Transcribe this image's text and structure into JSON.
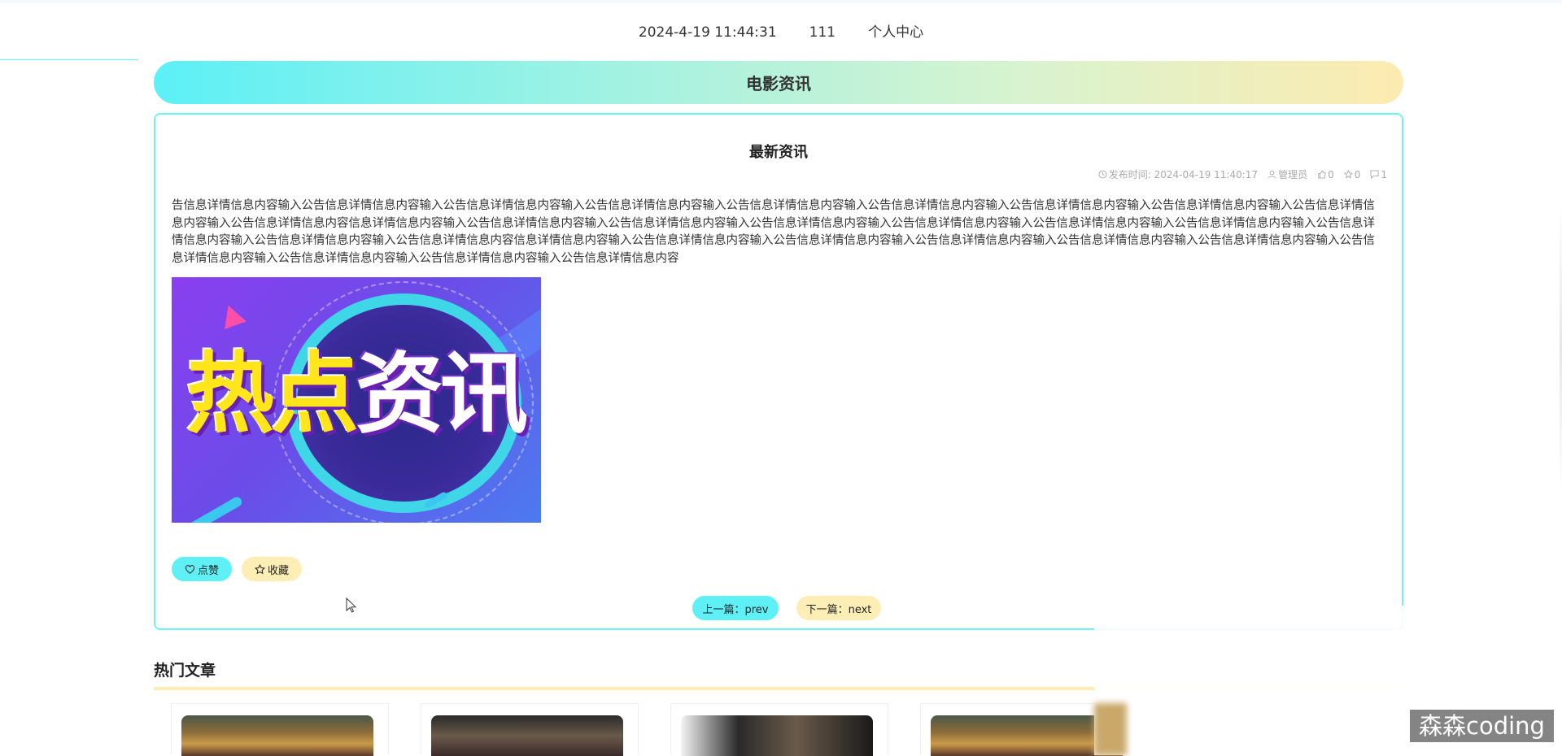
{
  "header": {
    "datetime": "2024-4-19 11:44:31",
    "username": "111",
    "profile_link": "个人中心"
  },
  "banner": {
    "title": "电影资讯"
  },
  "article": {
    "title": "最新资讯",
    "meta": {
      "publish_label": "发布时间: 2024-04-19 11:40:17",
      "author": "管理员",
      "likes": "0",
      "favorites": "0",
      "comments": "1"
    },
    "content": "告信息详情信息内容输入公告信息详情信息内容输入公告信息详情信息内容输入公告信息详情信息内容输入公告信息详情信息内容输入公告信息详情信息内容输入公告信息详情信息内容输入公告信息详情信息内容输入公告信息详情信息内容输入公告信息详情信息内容信息详情信息内容输入公告信息详情信息内容输入公告信息详情信息内容输入公告信息详情信息内容输入公告信息详情信息内容输入公告信息详情信息内容输入公告信息详情信息内容输入公告信息详情信息内容输入公告信息详情信息内容输入公告信息详情信息内容信息详情信息内容输入公告信息详情信息内容输入公告信息详情信息内容输入公告信息详情信息内容输入公告信息详情信息内容输入公告信息详情信息内容输入公告信息详情信息内容输入公告信息详情信息内容输入公告信息详情信息内容输入公告信息详情信息内容",
    "poster_text_yellow": "热点",
    "poster_text_white": "资讯",
    "like_label": "点赞",
    "favorite_label": "收藏",
    "prev_label": "上一篇：prev",
    "next_label": "下一篇：next"
  },
  "hot": {
    "title": "热门文章"
  },
  "watermark": "森森coding",
  "colors": {
    "accent_cyan": "#5ff0f5",
    "accent_yellow": "#fdeeb6",
    "card_border": "#6ff2f4"
  },
  "icons": {
    "clock": "clock-icon",
    "user": "user-icon",
    "like": "thumbs-up-icon",
    "star": "star-icon",
    "comment": "comment-icon",
    "heart": "heart-icon"
  }
}
